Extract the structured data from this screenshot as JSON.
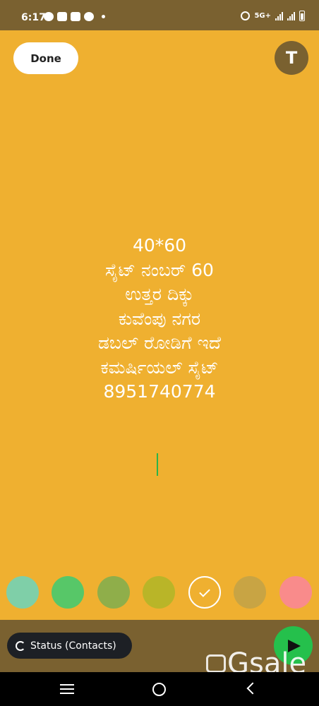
{
  "status_bar": {
    "time": "6:17",
    "network": "5G+"
  },
  "header": {
    "done_label": "Done",
    "text_tool_label": "T"
  },
  "status_text": {
    "lines": [
      "40*60",
      "ಸೈಟ್ ನಂಬರ್ 60",
      "ಉತ್ತರ ದಿಕ್ಕು",
      "ಕುವೆಂಪು ನಗರ",
      "ಡಬಲ್ ರೋಡಿಗೆ ಇದೆ",
      "ಕಮರ್ಷಿಯಲ್ ಸೈಟ್",
      "8951740774"
    ]
  },
  "palette": {
    "colors": [
      "#7fcfa8",
      "#57c768",
      "#8fae4a",
      "#b9b528",
      "#efb030",
      "#c8a444",
      "#f98b8b"
    ],
    "selected_index": 4
  },
  "bottom_bar": {
    "audience_label": "Status (Contacts)"
  },
  "watermark": {
    "text": "Gsale"
  }
}
